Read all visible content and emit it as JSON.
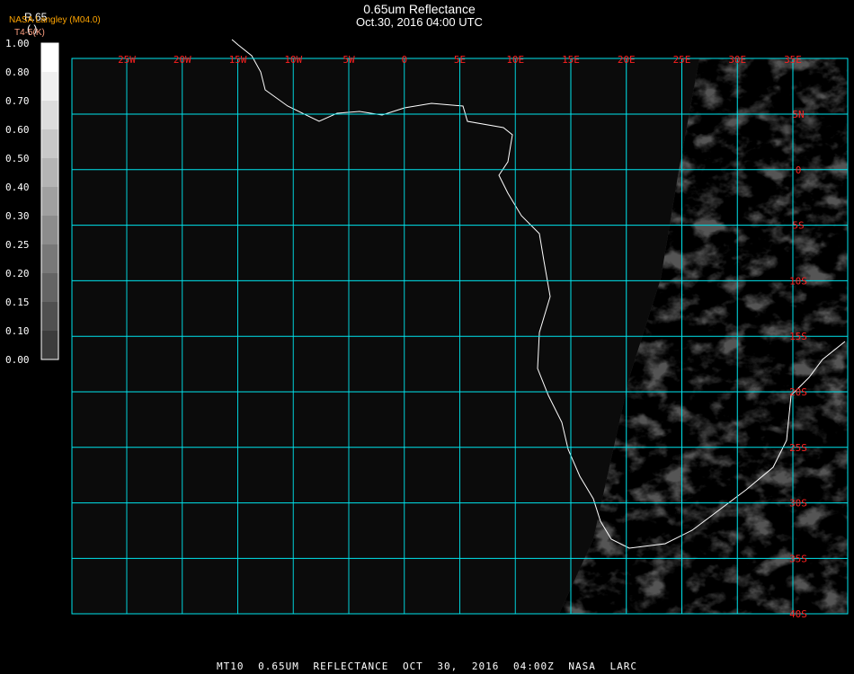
{
  "header": {
    "title": "0.65um Reflectance",
    "subtitle": "Oct.30, 2016 04:00 UTC"
  },
  "legend": {
    "name": "R.65",
    "units": "(   )",
    "organization": "NASA Langley (M04.0)",
    "temperature_label": "T4-5(K)",
    "ticks": [
      "1.00",
      "0.80",
      "0.70",
      "0.60",
      "0.50",
      "0.40",
      "0.30",
      "0.25",
      "0.20",
      "0.15",
      "0.10",
      "0.00"
    ],
    "colors": [
      "#ffffff",
      "#f0f0f0",
      "#dcdcdc",
      "#c8c8c8",
      "#b4b4b4",
      "#a0a0a0",
      "#8c8c8c",
      "#787878",
      "#646464",
      "#505050",
      "#3c3c3c",
      "#1e1e1e"
    ]
  },
  "map": {
    "lon_labels": [
      "25W",
      "20W",
      "15W",
      "10W",
      "5W",
      "0",
      "5E",
      "10E",
      "15E",
      "20E",
      "25E",
      "30E",
      "35E"
    ],
    "lat_labels": [
      "5N",
      "0",
      "5S",
      "10S",
      "15S",
      "20S",
      "25S",
      "30S",
      "35S",
      "40S"
    ],
    "grid_color": "#00e5ee",
    "label_color": "#ff2020",
    "coast_color": "#ffffff"
  },
  "footer": "MT10 0.65UM REFLECTANCE OCT 30, 2016 04:00Z NASA LARC"
}
